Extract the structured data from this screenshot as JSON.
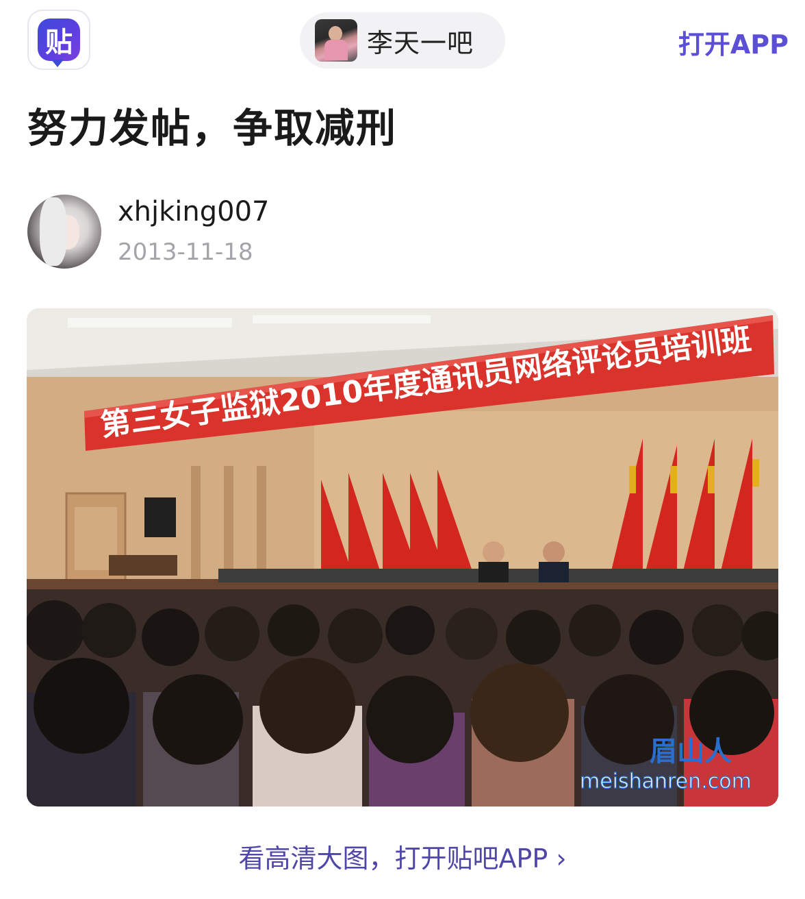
{
  "header": {
    "app_icon_glyph": "贴",
    "forum_name": "李天一吧",
    "open_app_label": "打开APP"
  },
  "post": {
    "title": "努力发帖，争取减刑",
    "author": "xhjking007",
    "date": "2013-11-18"
  },
  "photo": {
    "banner_text": "第三女子监狱2010年度通讯员网络评论员培训班",
    "watermark_cn": "眉山人",
    "watermark_url": "meishanren.com"
  },
  "footer": {
    "view_hd_label": "看高清大图，打开贴吧APP ›"
  },
  "colors": {
    "accent": "#5b4fd6",
    "link": "#4f47a8",
    "muted": "#a4a4a8",
    "banner_red": "#d9332b"
  }
}
